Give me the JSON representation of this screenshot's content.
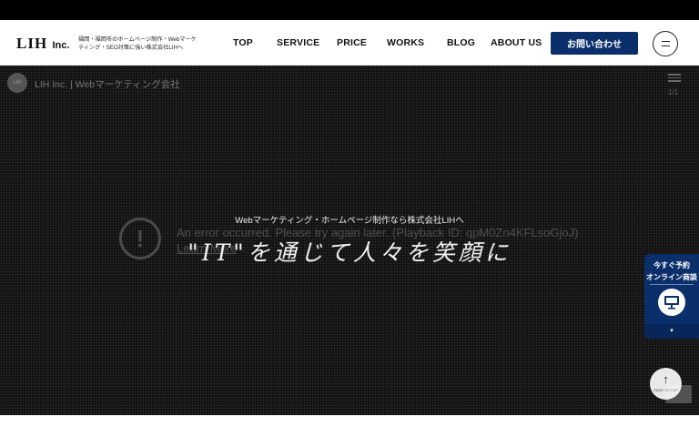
{
  "header": {
    "logo_main": "LIH",
    "logo_suffix": "Inc.",
    "tagline": "福岡・福岡市のホームページ制作・Webマーケティング・SEO対策に強い株式会社LIHへ",
    "nav": [
      "TOP",
      "SERVICE",
      "PRICE",
      "WORKS",
      "BLOG",
      "ABOUT US"
    ],
    "cta_label": "お問い合わせ"
  },
  "video": {
    "avatar_text": "LIH",
    "title": "LIH Inc. | Webマーケティング会社",
    "count": "1/1",
    "error_message": "An error occurred. Please try again later. (Playback ID: qpM0Zn4KFLsoGjoJ)",
    "learn_more": "Learn More"
  },
  "hero": {
    "subtitle": "Webマーケティング・ホームページ制作なら株式会社LIHへ",
    "headline": "\"IT\"を通じて人々を笑顔に"
  },
  "side_widget": {
    "line1": "今すぐ予約",
    "line2": "オンライン商談",
    "chevron": "▾"
  },
  "page_top": {
    "arrow": "↑",
    "label": "PAGE TO TOP"
  },
  "colors": {
    "brand_navy": "#0a2f6b",
    "hero_bg": "#141414"
  }
}
